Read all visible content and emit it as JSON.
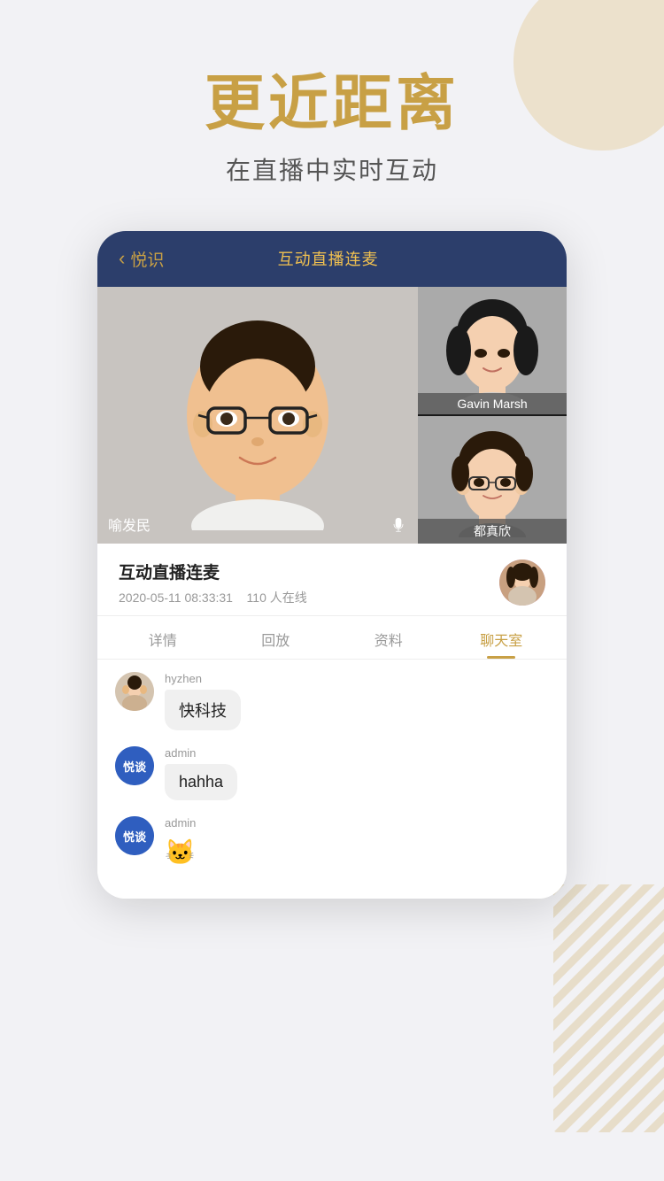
{
  "background": {
    "topCircleColor": "#e8d5b0",
    "stripeColor": "#c8a045"
  },
  "header": {
    "mainTitle": "更近距离",
    "subTitle": "在直播中实时互动"
  },
  "app": {
    "backLabel": "悦识",
    "appTitle": "互动直播连麦",
    "videoGrid": {
      "mainSpeaker": {
        "name": "喻发民",
        "hasMic": true
      },
      "sideUsers": [
        {
          "name": "Gavin Marsh"
        },
        {
          "name": "都真欣"
        }
      ]
    },
    "liveInfo": {
      "title": "互动直播连麦",
      "date": "2020-05-11 08:33:31",
      "online": "110 人在线"
    },
    "tabs": [
      {
        "label": "详情",
        "active": false
      },
      {
        "label": "回放",
        "active": false
      },
      {
        "label": "资料",
        "active": false
      },
      {
        "label": "聊天室",
        "active": true
      }
    ],
    "chat": {
      "messages": [
        {
          "username": "hyzhen",
          "avatarType": "photo",
          "bubble": "快科技"
        },
        {
          "username": "admin",
          "avatarType": "logo",
          "bubble": "hahha"
        },
        {
          "username": "admin",
          "avatarType": "logo",
          "bubble": "🐱"
        }
      ]
    }
  }
}
